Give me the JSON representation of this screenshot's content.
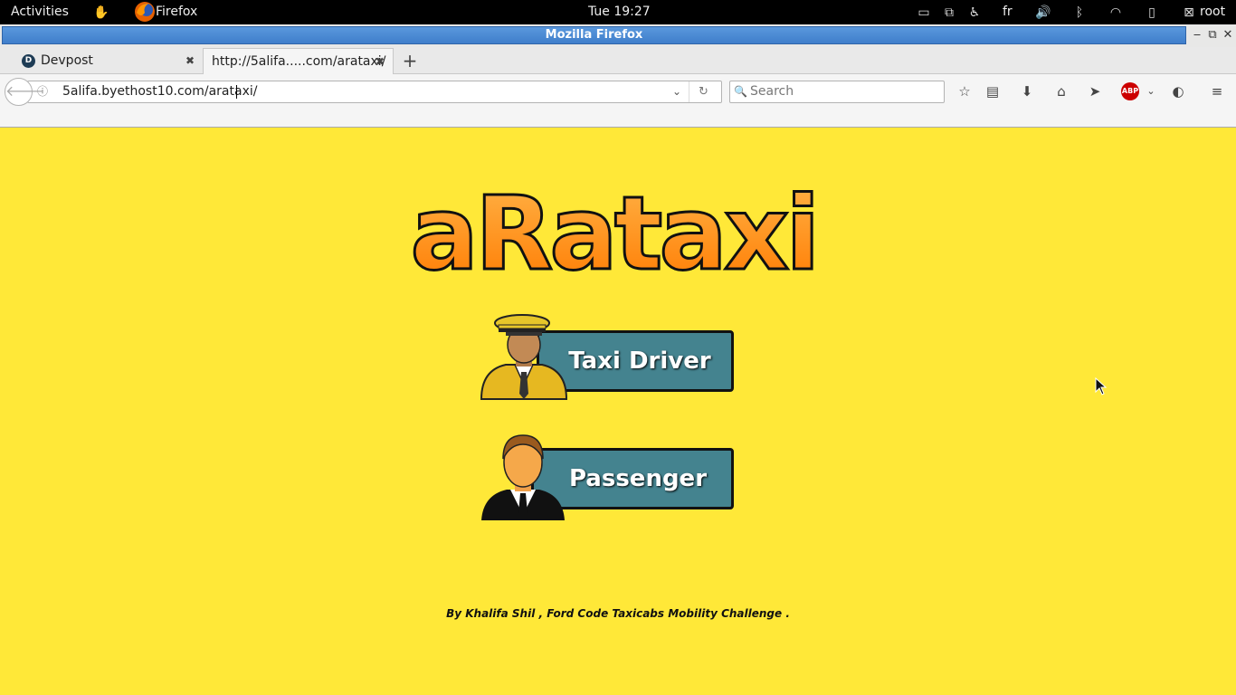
{
  "topbar": {
    "activities": "Activities",
    "app_name": "Firefox",
    "clock": "Tue 19:27",
    "keyboard_layout": "fr",
    "user": "root"
  },
  "window": {
    "title": "Mozilla Firefox"
  },
  "tabs": [
    {
      "label": "Devpost",
      "favicon_letter": "D",
      "active": false
    },
    {
      "label": "http://5alifa.....com/arataxi/",
      "active": true
    }
  ],
  "navbar": {
    "url": "5alifa.byethost10.com/arataxi/",
    "search_placeholder": "Search"
  },
  "page": {
    "logo_text": "aRataxi",
    "buttons": [
      {
        "label": "Taxi Driver",
        "avatar": "taxi-driver-avatar"
      },
      {
        "label": "Passenger",
        "avatar": "passenger-avatar"
      }
    ],
    "footer": "By Khalifa Shil , Ford Code Taxicabs Mobility Challenge ."
  },
  "colors": {
    "page_background": "#ffe838",
    "button_fill": "#44838f",
    "logo_orange_top": "#ffb347",
    "logo_orange_bottom": "#ff7a00",
    "titlebar_blue": "#4a89d6"
  }
}
